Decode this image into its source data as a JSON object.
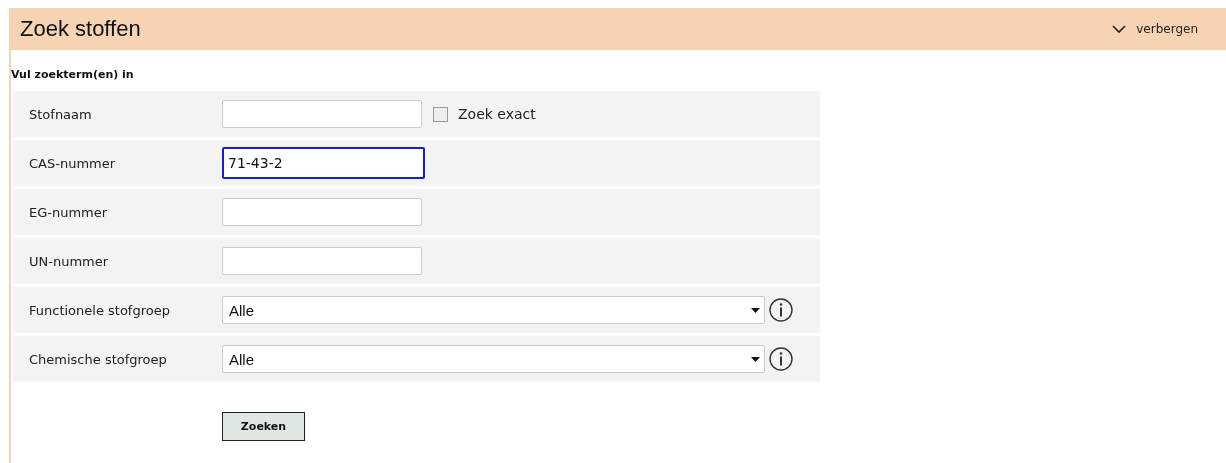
{
  "panel": {
    "title": "Zoek stoffen",
    "toggle": {
      "label": "verbergen",
      "expanded": true
    }
  },
  "form": {
    "heading": "Vul zoekterm(en) in",
    "fields": [
      {
        "kind": "text",
        "label": "Stofnaam",
        "focused": false,
        "checkbox": {
          "label": "Zoek exact",
          "checked": false
        }
      },
      {
        "kind": "text",
        "label": "CAS-nummer",
        "value": "71-43-2",
        "focused": true
      },
      {
        "kind": "text",
        "label": "EG-nummer",
        "focused": false
      },
      {
        "kind": "text",
        "label": "UN-nummer",
        "focused": false
      },
      {
        "kind": "select",
        "label": "Functionele stofgroep",
        "value": "Alle"
      },
      {
        "kind": "select",
        "label": "Chemische stofgroep",
        "value": "Alle"
      }
    ],
    "submit": "Zoeken"
  }
}
